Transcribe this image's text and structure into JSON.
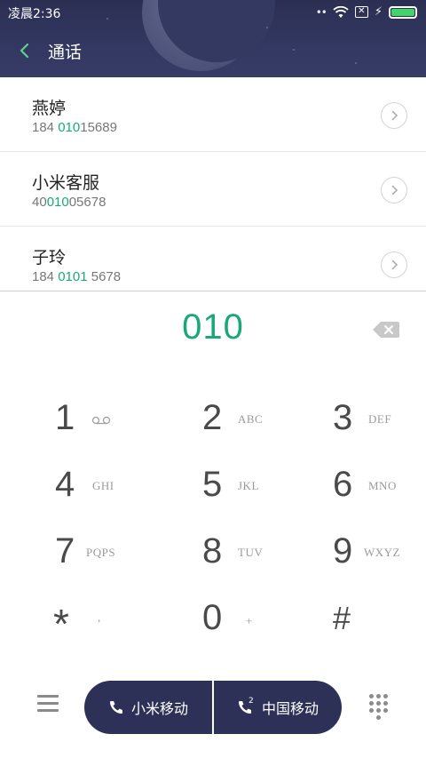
{
  "status_bar": {
    "time": "凌晨2:36",
    "signal_dots": "••"
  },
  "header": {
    "title": "通话"
  },
  "results": [
    {
      "name": "燕婷",
      "number_pre": "184 ",
      "number_match": "010",
      "number_post": "15689"
    },
    {
      "name": "小米客服",
      "number_pre": "40",
      "number_match": "010",
      "number_post": "05678"
    },
    {
      "name": "子玲",
      "number_pre": "184 ",
      "number_match": "0101",
      "number_post": " 5678"
    }
  ],
  "dial_input": {
    "value": "010"
  },
  "keypad": [
    {
      "digit": "1",
      "letters": ""
    },
    {
      "digit": "2",
      "letters": "ABC"
    },
    {
      "digit": "3",
      "letters": "DEF"
    },
    {
      "digit": "4",
      "letters": "GHI"
    },
    {
      "digit": "5",
      "letters": "JKL"
    },
    {
      "digit": "6",
      "letters": "MNO"
    },
    {
      "digit": "7",
      "letters": "PQPS"
    },
    {
      "digit": "8",
      "letters": "TUV"
    },
    {
      "digit": "9",
      "letters": "WXYZ"
    },
    {
      "digit": "*",
      "letters": ","
    },
    {
      "digit": "0",
      "letters": "+"
    },
    {
      "digit": "#",
      "letters": ""
    }
  ],
  "call_buttons": {
    "sim1_label": "小米移动",
    "sim2_label": "中国移动",
    "sim2_index": "2"
  },
  "colors": {
    "accent": "#1aa87a",
    "header_bg": "#333862",
    "call_bar_bg": "#2e3157"
  },
  "icons": {
    "back": "back-chevron-icon",
    "detail": "chevron-right-icon",
    "backspace": "backspace-icon",
    "voicemail": "voicemail-icon",
    "menu": "menu-icon",
    "dialpad": "dialpad-icon",
    "phone": "phone-icon"
  }
}
